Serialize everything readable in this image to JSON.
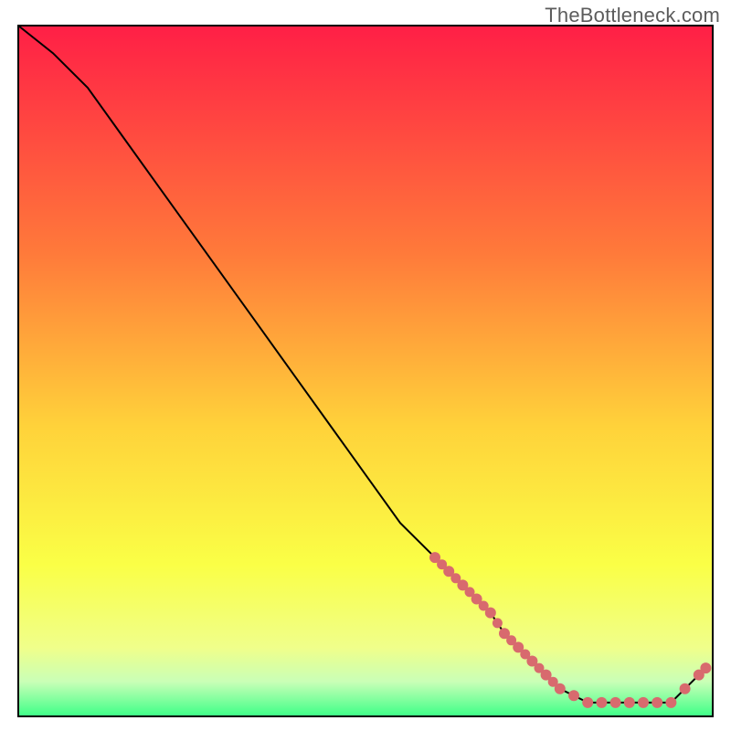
{
  "watermark": "TheBottleneck.com",
  "colors": {
    "gradient_top": "#ff1f46",
    "gradient_mid_upper": "#ff7a3a",
    "gradient_mid": "#ffd23a",
    "gradient_mid_lower": "#faff46",
    "gradient_green_light": "#c9ffb7",
    "gradient_green": "#3dff87",
    "line": "#000000",
    "dot": "#d86a6e",
    "border": "#000000"
  },
  "chart_data": {
    "type": "line",
    "title": "",
    "xlabel": "",
    "ylabel": "",
    "xlim": [
      0,
      100
    ],
    "ylim": [
      0,
      100
    ],
    "x": [
      0,
      5,
      10,
      15,
      20,
      25,
      30,
      35,
      40,
      45,
      50,
      55,
      60,
      62,
      64,
      66,
      68,
      70,
      72,
      74,
      76,
      78,
      80,
      82,
      84,
      86,
      88,
      90,
      92,
      94,
      96,
      98,
      99
    ],
    "y": [
      100,
      96,
      91,
      84,
      77,
      70,
      63,
      56,
      49,
      42,
      35,
      28,
      23,
      21,
      19,
      17,
      15,
      12,
      10,
      8,
      6,
      4,
      3,
      2,
      2,
      2,
      2,
      2,
      2,
      2,
      4,
      6,
      7
    ],
    "dot_segment1_indices": [
      12,
      13,
      14,
      15,
      16,
      17,
      18,
      19,
      20,
      21
    ],
    "dot_segment2_indices": [
      22,
      23,
      24,
      25,
      26,
      27,
      28,
      29,
      30,
      31,
      32
    ]
  }
}
